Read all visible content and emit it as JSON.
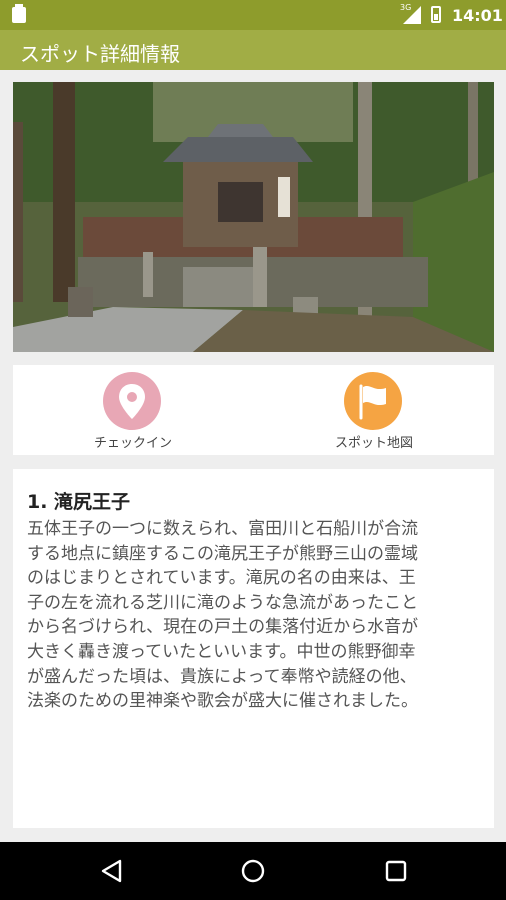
{
  "status_bar": {
    "network_type": "3G",
    "time": "14:01"
  },
  "app_bar": {
    "title": "スポット詳細情報"
  },
  "actions": [
    {
      "label": "チェックイン",
      "icon": "map-pin-icon",
      "color": "#e8a7b5"
    },
    {
      "label": "スポット地図",
      "icon": "flag-icon",
      "color": "#f5a443"
    }
  ],
  "spot": {
    "title": "1. 滝尻王子",
    "description_lines": [
      "五体王子の一つに数えられ、富田川と石船川が合流",
      "する地点に鎮座するこの滝尻王子が熊野三山の霊域",
      "のはじまりとされています。滝尻の名の由来は、王",
      "子の左を流れる芝川に滝のような急流があったこと",
      "から名づけられ、現在の戸土の集落付近から水音が",
      "大きく轟き渡っていたといいます。中世の熊野御幸",
      "が盛んだった頃は、貴族によって奉幣や読経の他、",
      "法楽のための里神楽や歌会が盛大に催されました。"
    ]
  },
  "colors": {
    "status_bar": "#8e9c2c",
    "app_bar": "#a1ad45",
    "background": "#eeeeee"
  }
}
